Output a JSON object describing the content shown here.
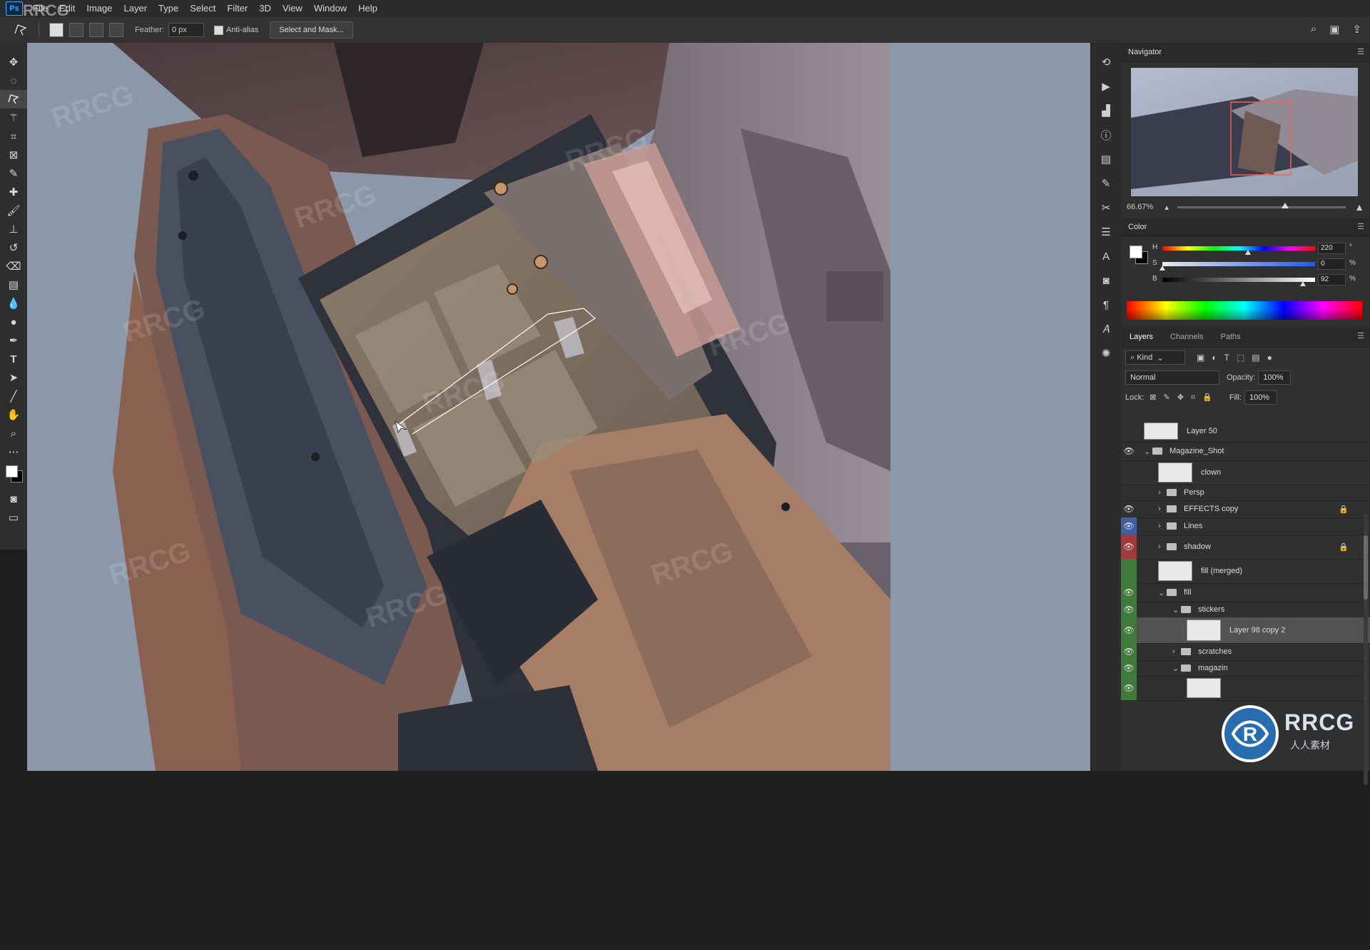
{
  "app": {
    "logo": "Ps",
    "watermark_corner": "RRCG"
  },
  "menu": [
    "File",
    "Edit",
    "Image",
    "Layer",
    "Type",
    "Select",
    "Filter",
    "3D",
    "View",
    "Window",
    "Help"
  ],
  "options": {
    "feather_label": "Feather:",
    "feather_value": "0 px",
    "antialias_label": "Anti-alias",
    "select_mask_label": "Select and Mask..."
  },
  "navigator": {
    "title": "Navigator",
    "zoom": "66.67%"
  },
  "color": {
    "title": "Color",
    "h": {
      "label": "H",
      "value": "220",
      "unit": "°",
      "position": 0.56
    },
    "s": {
      "label": "S",
      "value": "0",
      "unit": "%",
      "position": 0.0
    },
    "b": {
      "label": "B",
      "value": "92",
      "unit": "%",
      "position": 0.92
    }
  },
  "layers_panel": {
    "tabs": [
      "Layers",
      "Channels",
      "Paths"
    ],
    "filter_kind": "Kind",
    "blend_mode": "Normal",
    "opacity_label": "Opacity:",
    "opacity_value": "100%",
    "lock_label": "Lock:",
    "fill_label": "Fill:",
    "fill_value": "100%",
    "rows": [
      {
        "name": "Layer 50",
        "visible": false,
        "type": "layer",
        "indent": 0
      },
      {
        "name": "Magazine_Shot",
        "visible": true,
        "type": "group",
        "indent": 0,
        "expanded": true
      },
      {
        "name": "clown",
        "visible": false,
        "type": "layer",
        "indent": 1
      },
      {
        "name": "Persp",
        "visible": false,
        "type": "group",
        "indent": 1
      },
      {
        "name": "EFFECTS copy",
        "visible": true,
        "type": "group",
        "indent": 1,
        "locked": true
      },
      {
        "name": "Lines",
        "visible": true,
        "type": "group",
        "indent": 1,
        "color": "#3f5f9f"
      },
      {
        "name": "shadow",
        "visible": true,
        "type": "group",
        "indent": 1,
        "locked": true,
        "color": "#9f3a3a"
      },
      {
        "name": "fill (merged)",
        "visible": false,
        "type": "layer",
        "indent": 1,
        "color": "#3f7a3a"
      },
      {
        "name": "fill",
        "visible": true,
        "type": "group",
        "indent": 1,
        "expanded": true,
        "color": "#3f7a3a"
      },
      {
        "name": "stickers",
        "visible": true,
        "type": "group",
        "indent": 2,
        "expanded": true,
        "color": "#3f7a3a"
      },
      {
        "name": "Layer 98 copy 2",
        "visible": true,
        "type": "layer",
        "indent": 3,
        "selected": true,
        "color": "#3f7a3a"
      },
      {
        "name": "scratches",
        "visible": true,
        "type": "group",
        "indent": 2,
        "color": "#3f7a3a"
      },
      {
        "name": "magazin",
        "visible": true,
        "type": "group",
        "indent": 2,
        "expanded": true,
        "color": "#3f7a3a"
      },
      {
        "name": "",
        "visible": true,
        "type": "layer",
        "indent": 3,
        "color": "#3f7a3a"
      }
    ]
  },
  "watermark": {
    "brand": "RRCG",
    "sub": "人人素材"
  }
}
